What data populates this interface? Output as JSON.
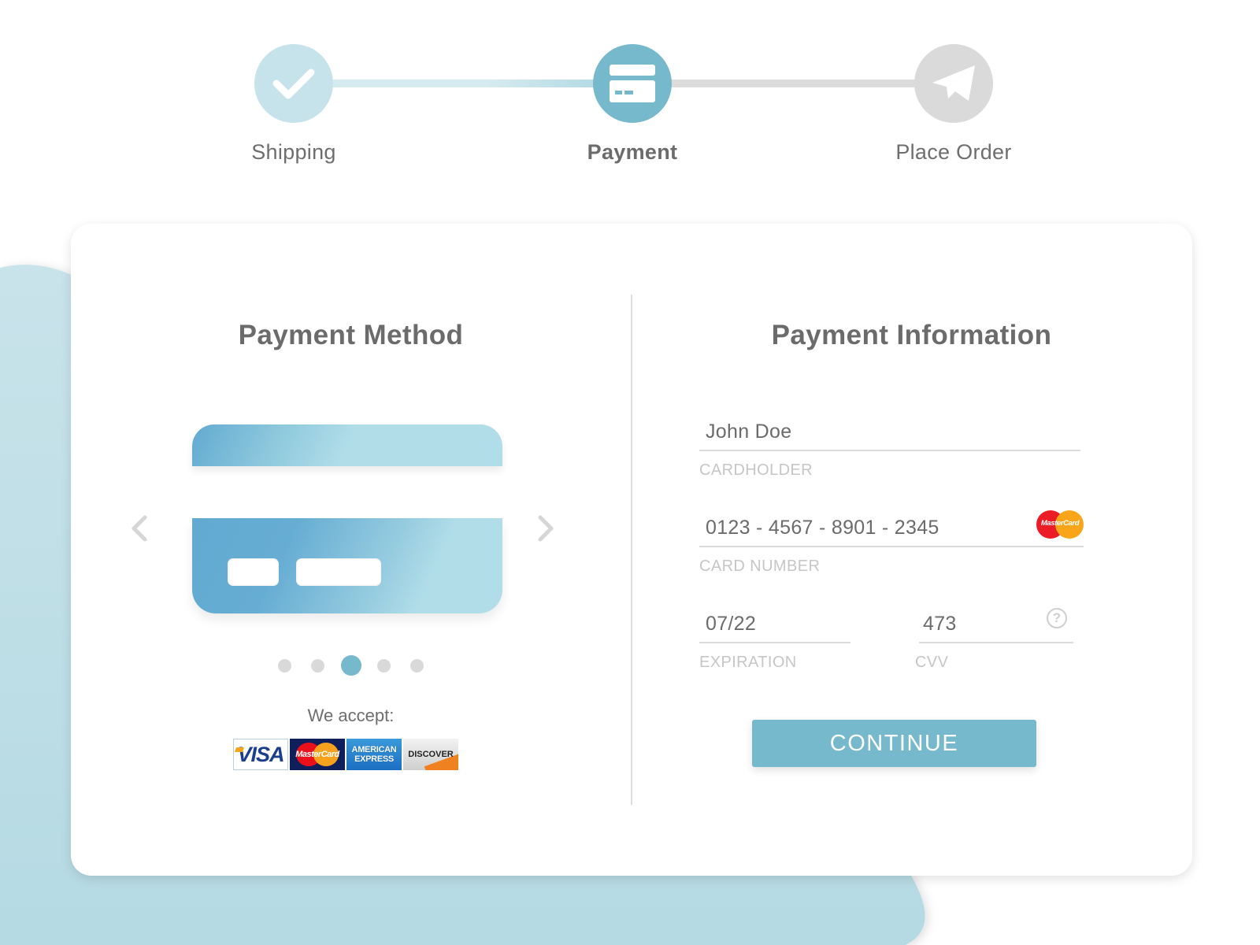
{
  "colors": {
    "accent": "#76b9cc",
    "accent_light": "#c6e2ea",
    "inactive": "#dadada",
    "background_blob": "#c6e2ea",
    "text": "#6b6b6b",
    "label": "#c6c6c6"
  },
  "stepper": {
    "steps": [
      {
        "label": "Shipping",
        "icon": "check-icon",
        "state": "completed"
      },
      {
        "label": "Payment",
        "icon": "credit-card-icon",
        "state": "active"
      },
      {
        "label": "Place Order",
        "icon": "paper-plane-icon",
        "state": "pending"
      }
    ]
  },
  "payment_method": {
    "title": "Payment Method",
    "carousel": {
      "prev_icon": "chevron-left-icon",
      "next_icon": "chevron-right-icon",
      "dot_count": 5,
      "active_index": 2
    },
    "accept_label": "We accept:",
    "accepted_cards": [
      {
        "name": "visa",
        "text": "VISA"
      },
      {
        "name": "mastercard",
        "text": "MasterCard"
      },
      {
        "name": "amex",
        "text_line1": "AMERICAN",
        "text_line2": "EXPRESS"
      },
      {
        "name": "discover",
        "text": "DISCOVER"
      }
    ]
  },
  "payment_information": {
    "title": "Payment Information",
    "fields": {
      "cardholder": {
        "value": "John Doe",
        "label": "CARDHOLDER"
      },
      "card_number": {
        "value": "0123 - 4567 - 8901 - 2345",
        "label": "CARD NUMBER",
        "brand": "MasterCard"
      },
      "expiration": {
        "value": "07/22",
        "label": "EXPIRATION"
      },
      "cvv": {
        "value": "473",
        "label": "CVV",
        "help_icon": "?"
      }
    },
    "continue_label": "CONTINUE"
  }
}
